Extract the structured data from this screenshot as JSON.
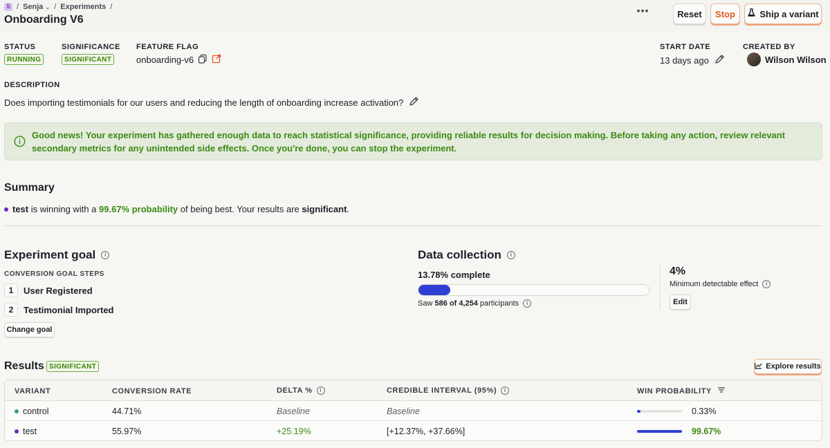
{
  "breadcrumb": {
    "project_initial": "S",
    "sep1": "/",
    "project": "Senja",
    "sep2": "/",
    "section": "Experiments",
    "sep3": "/"
  },
  "page_title": "Onboarding V6",
  "toolbar": {
    "more_icon": "ellipsis-icon",
    "reset_label": "Reset",
    "stop_label": "Stop",
    "ship_label": "Ship a variant"
  },
  "meta": {
    "status_label": "STATUS",
    "status_value": "RUNNING",
    "significance_label": "SIGNIFICANCE",
    "significance_value": "SIGNIFICANT",
    "flag_label": "FEATURE FLAG",
    "flag_value": "onboarding-v6",
    "start_label": "START DATE",
    "start_value": "13 days ago",
    "created_label": "CREATED BY",
    "created_value": "Wilson Wilson"
  },
  "description": {
    "label": "DESCRIPTION",
    "text": "Does importing testimonials for our users and reducing the length of onboarding increase activation?"
  },
  "alert": {
    "text": "Good news! Your experiment has gathered enough data to reach statistical significance, providing reliable results for decision making. Before taking any action, review relevant secondary metrics for any unintended side effects. Once you're done, you can stop the experiment."
  },
  "summary": {
    "title": "Summary",
    "variant": "test",
    "text1": " is winning with a ",
    "probability": "99.67% probability",
    "text2": " of being best. Your results are ",
    "significant": "significant",
    "text3": "."
  },
  "goal": {
    "title": "Experiment goal",
    "steps_label": "CONVERSION GOAL STEPS",
    "steps": [
      {
        "num": "1",
        "label": "User Registered"
      },
      {
        "num": "2",
        "label": "Testimonial Imported"
      }
    ],
    "change_label": "Change goal"
  },
  "data_collection": {
    "title": "Data collection",
    "complete": "13.78% complete",
    "progress": 0.1378,
    "saw_prefix": "Saw ",
    "saw_count": "586 of 4,254",
    "saw_suffix": " participants",
    "mde_value": "4%",
    "mde_label": "Minimum detectable effect",
    "edit_label": "Edit"
  },
  "results": {
    "title": "Results",
    "badge": "SIGNIFICANT",
    "explore_label": "Explore results",
    "columns": [
      "VARIANT",
      "CONVERSION RATE",
      "DELTA %",
      "CREDIBLE INTERVAL (95%)",
      "WIN PROBABILITY"
    ],
    "rows": [
      {
        "variant": "control",
        "color": "#3b9b8e",
        "rate": "44.71%",
        "delta": "Baseline",
        "interval": "Baseline",
        "win": "0.33%",
        "win_fraction": 0.0033
      },
      {
        "variant": "test",
        "color": "#6b2bb5",
        "rate": "55.97%",
        "delta": "+25.19%",
        "interval": "[+12.37%, +37.66%]",
        "win": "99.67%",
        "win_fraction": 0.9967
      }
    ]
  },
  "colors": {
    "accent": "#2f3fd6",
    "success": "#388600",
    "stop": "#e5561f"
  }
}
